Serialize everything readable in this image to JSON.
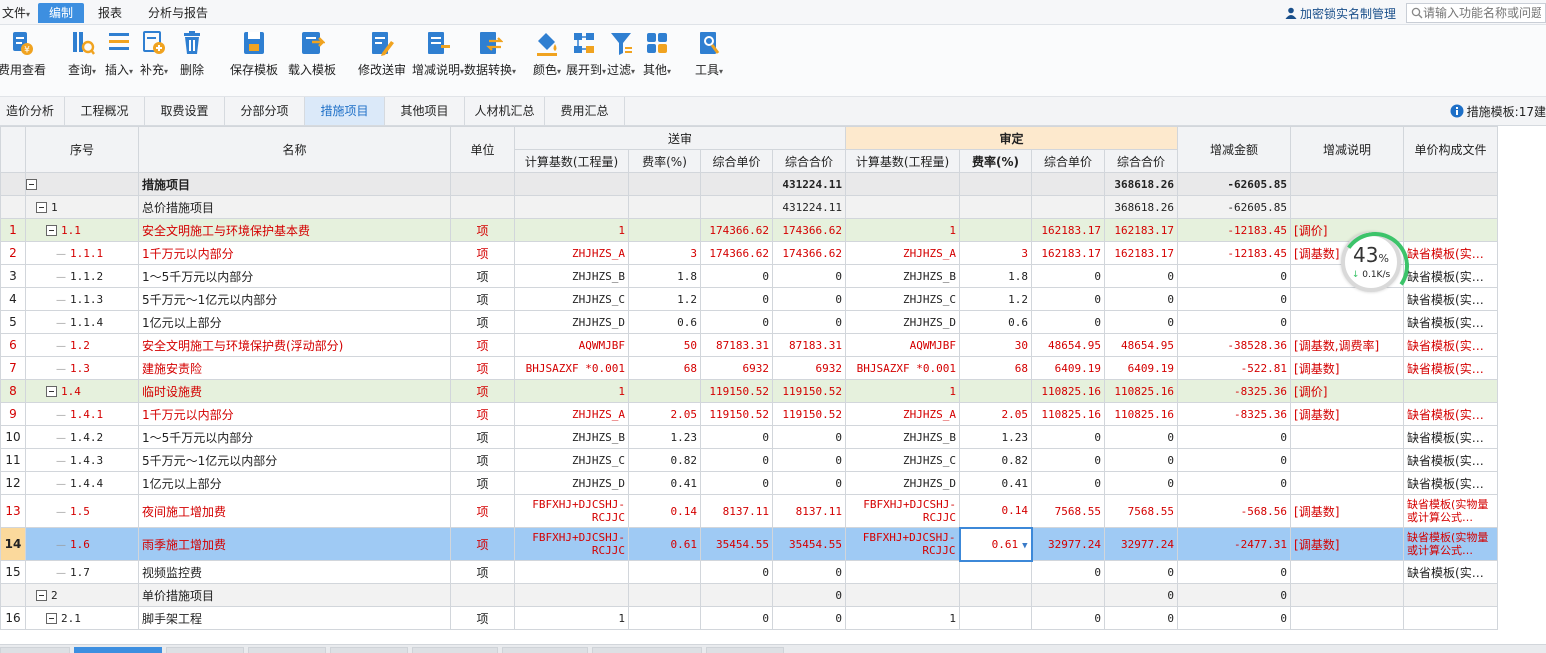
{
  "menu": {
    "file": "文件",
    "edit": "编制",
    "report": "报表",
    "analysis": "分析与报告",
    "lock_label": "加密锁实名制管理",
    "search_placeholder": "请输入功能名称或问题"
  },
  "toolbar": {
    "fee_view": "费用查看",
    "query": "查询",
    "insert": "插入",
    "supplement": "补充",
    "delete": "删除",
    "save_template": "保存模板",
    "load_template": "载入模板",
    "modify_submit": "修改送审",
    "change_note": "增减说明",
    "data_convert": "数据转换",
    "color": "颜色",
    "expand_to": "展开到",
    "filter": "过滤",
    "other": "其他",
    "tools": "工具"
  },
  "tabs": [
    "造价分析",
    "工程概况",
    "取费设置",
    "分部分项",
    "措施项目",
    "其他项目",
    "人材机汇总",
    "费用汇总"
  ],
  "tabs_active": "措施项目",
  "template_label": "措施模板:17建",
  "grid": {
    "headers": {
      "seq": "序号",
      "name": "名称",
      "unit": "单位",
      "submitted": "送审",
      "approved": "审定",
      "calc_base": "计算基数(工程量)",
      "rate": "费率(%)",
      "unit_price": "综合单价",
      "total": "综合合价",
      "diff": "增减金额",
      "diff_note": "增减说明",
      "price_file": "单价构成文件"
    },
    "rows": [
      {
        "rn": "",
        "seq": "",
        "name": "措施项目",
        "unit": "",
        "s_base": "",
        "s_rate": "",
        "s_price": "",
        "s_total": "431224.11",
        "a_base": "",
        "a_rate": "",
        "a_price": "",
        "a_total": "368618.26",
        "diff": "-62605.85",
        "note": "",
        "file": ""
      },
      {
        "rn": "",
        "seq": "1",
        "name": "总价措施项目",
        "unit": "",
        "s_base": "",
        "s_rate": "",
        "s_price": "",
        "s_total": "431224.11",
        "a_base": "",
        "a_rate": "",
        "a_price": "",
        "a_total": "368618.26",
        "diff": "-62605.85",
        "note": "",
        "file": ""
      },
      {
        "rn": "\u0002 1",
        "seq": "1.1",
        "name": "安全文明施工与环境保护基本费",
        "unit": "项",
        "s_base": "1",
        "s_rate": "",
        "s_price": "174366.62",
        "s_total": "174366.62",
        "a_base": "1",
        "a_rate": "",
        "a_price": "162183.17",
        "a_total": "162183.17",
        "diff": "-12183.45",
        "note": "[调价]",
        "file": ""
      },
      {
        "rn": "\u0002 2",
        "seq": "1.1.1",
        "name": "1千万元以内部分",
        "unit": "项",
        "s_base": "ZHJHZS_A",
        "s_rate": "3",
        "s_price": "174366.62",
        "s_total": "174366.62",
        "a_base": "ZHJHZS_A",
        "a_rate": "3",
        "a_price": "162183.17",
        "a_total": "162183.17",
        "diff": "-12183.45",
        "note": "[调基数]",
        "file": "缺省模板(实…"
      },
      {
        "rn": "3",
        "seq": "1.1.2",
        "name": "1～5千万元以内部分",
        "unit": "项",
        "s_base": "ZHJHZS_B",
        "s_rate": "1.8",
        "s_price": "0",
        "s_total": "0",
        "a_base": "ZHJHZS_B",
        "a_rate": "1.8",
        "a_price": "0",
        "a_total": "0",
        "diff": "0",
        "note": "",
        "file": "缺省模板(实…"
      },
      {
        "rn": "4",
        "seq": "1.1.3",
        "name": "5千万元～1亿元以内部分",
        "unit": "项",
        "s_base": "ZHJHZS_C",
        "s_rate": "1.2",
        "s_price": "0",
        "s_total": "0",
        "a_base": "ZHJHZS_C",
        "a_rate": "1.2",
        "a_price": "0",
        "a_total": "0",
        "diff": "0",
        "note": "",
        "file": "缺省模板(实…"
      },
      {
        "rn": "5",
        "seq": "1.1.4",
        "name": "1亿元以上部分",
        "unit": "项",
        "s_base": "ZHJHZS_D",
        "s_rate": "0.6",
        "s_price": "0",
        "s_total": "0",
        "a_base": "ZHJHZS_D",
        "a_rate": "0.6",
        "a_price": "0",
        "a_total": "0",
        "diff": "0",
        "note": "",
        "file": "缺省模板(实…"
      },
      {
        "rn": "\u0002 6",
        "seq": "1.2",
        "name": "安全文明施工与环境保护费(浮动部分)",
        "unit": "项",
        "s_base": "AQWMJBF",
        "s_rate": "50",
        "s_price": "87183.31",
        "s_total": "87183.31",
        "a_base": "AQWMJBF",
        "a_rate": "30",
        "a_price": "48654.95",
        "a_total": "48654.95",
        "diff": "-38528.36",
        "note": "[调基数,调费率]",
        "file": "缺省模板(实…"
      },
      {
        "rn": "\u0002 7",
        "seq": "1.3",
        "name": "建施安责险",
        "unit": "项",
        "s_base": "BHJSAZXF *0.001",
        "s_rate": "68",
        "s_price": "6932",
        "s_total": "6932",
        "a_base": "BHJSAZXF *0.001",
        "a_rate": "68",
        "a_price": "6409.19",
        "a_total": "6409.19",
        "diff": "-522.81",
        "note": "[调基数]",
        "file": "缺省模板(实…"
      },
      {
        "rn": "\u0002 8",
        "seq": "1.4",
        "name": "临时设施费",
        "unit": "项",
        "s_base": "1",
        "s_rate": "",
        "s_price": "119150.52",
        "s_total": "119150.52",
        "a_base": "1",
        "a_rate": "",
        "a_price": "110825.16",
        "a_total": "110825.16",
        "diff": "-8325.36",
        "note": "[调价]",
        "file": ""
      },
      {
        "rn": "\u0002 9",
        "seq": "1.4.1",
        "name": "1千万元以内部分",
        "unit": "项",
        "s_base": "ZHJHZS_A",
        "s_rate": "2.05",
        "s_price": "119150.52",
        "s_total": "119150.52",
        "a_base": "ZHJHZS_A",
        "a_rate": "2.05",
        "a_price": "110825.16",
        "a_total": "110825.16",
        "diff": "-8325.36",
        "note": "[调基数]",
        "file": "缺省模板(实…"
      },
      {
        "rn": "10",
        "seq": "1.4.2",
        "name": "1～5千万元以内部分",
        "unit": "项",
        "s_base": "ZHJHZS_B",
        "s_rate": "1.23",
        "s_price": "0",
        "s_total": "0",
        "a_base": "ZHJHZS_B",
        "a_rate": "1.23",
        "a_price": "0",
        "a_total": "0",
        "diff": "0",
        "note": "",
        "file": "缺省模板(实…"
      },
      {
        "rn": "11",
        "seq": "1.4.3",
        "name": "5千万元～1亿元以内部分",
        "unit": "项",
        "s_base": "ZHJHZS_C",
        "s_rate": "0.82",
        "s_price": "0",
        "s_total": "0",
        "a_base": "ZHJHZS_C",
        "a_rate": "0.82",
        "a_price": "0",
        "a_total": "0",
        "diff": "0",
        "note": "",
        "file": "缺省模板(实…"
      },
      {
        "rn": "12",
        "seq": "1.4.4",
        "name": "1亿元以上部分",
        "unit": "项",
        "s_base": "ZHJHZS_D",
        "s_rate": "0.41",
        "s_price": "0",
        "s_total": "0",
        "a_base": "ZHJHZS_D",
        "a_rate": "0.41",
        "a_price": "0",
        "a_total": "0",
        "diff": "0",
        "note": "",
        "file": "缺省模板(实…"
      },
      {
        "rn": "\u0002 13",
        "seq": "1.5",
        "name": "夜间施工增加费",
        "unit": "项",
        "s_base": "FBFXHJ+DJCSHJ-RCJJC",
        "s_rate": "0.14",
        "s_price": "8137.11",
        "s_total": "8137.11",
        "a_base": "FBFXHJ+DJCSHJ-RCJJC",
        "a_rate": "0.14",
        "a_price": "7568.55",
        "a_total": "7568.55",
        "diff": "-568.56",
        "note": "[调基数]",
        "file": "缺省模板(实物量或计算公式…"
      },
      {
        "rn": "\u0002 14",
        "seq": "1.6",
        "name": "雨季施工增加费",
        "unit": "项",
        "s_base": "FBFXHJ+DJCSHJ-RCJJC",
        "s_rate": "0.61",
        "s_price": "35454.55",
        "s_total": "35454.55",
        "a_base": "FBFXHJ+DJCSHJ-RCJJC",
        "a_rate": "0.61",
        "a_price": "32977.24",
        "a_total": "32977.24",
        "diff": "-2477.31",
        "note": "[调基数]",
        "file": "缺省模板(实物量或计算公式…"
      },
      {
        "rn": "15",
        "seq": "1.7",
        "name": "视频监控费",
        "unit": "项",
        "s_base": "",
        "s_rate": "",
        "s_price": "0",
        "s_total": "0",
        "a_base": "",
        "a_rate": "",
        "a_price": "0",
        "a_total": "0",
        "diff": "0",
        "note": "",
        "file": "缺省模板(实…"
      },
      {
        "rn": "",
        "seq": "2",
        "name": "单价措施项目",
        "unit": "",
        "s_base": "",
        "s_rate": "",
        "s_price": "",
        "s_total": "0",
        "a_base": "",
        "a_rate": "",
        "a_price": "",
        "a_total": "0",
        "diff": "0",
        "note": "",
        "file": ""
      },
      {
        "rn": "16",
        "seq": "2.1",
        "name": "脚手架工程",
        "unit": "项",
        "s_base": "1",
        "s_rate": "",
        "s_price": "0",
        "s_total": "0",
        "a_base": "1",
        "a_rate": "",
        "a_price": "0",
        "a_total": "0",
        "diff": "0",
        "note": "",
        "file": ""
      }
    ]
  },
  "speed": {
    "percent": "43",
    "percent_unit": "%",
    "rate": "0.1K/s"
  },
  "colors": {
    "accent": "#3d8fe0",
    "red_text": "#d40000",
    "green_row": "#e6f1dd",
    "selected_row": "#9fcaf4",
    "approved_header": "#fde9cd"
  }
}
